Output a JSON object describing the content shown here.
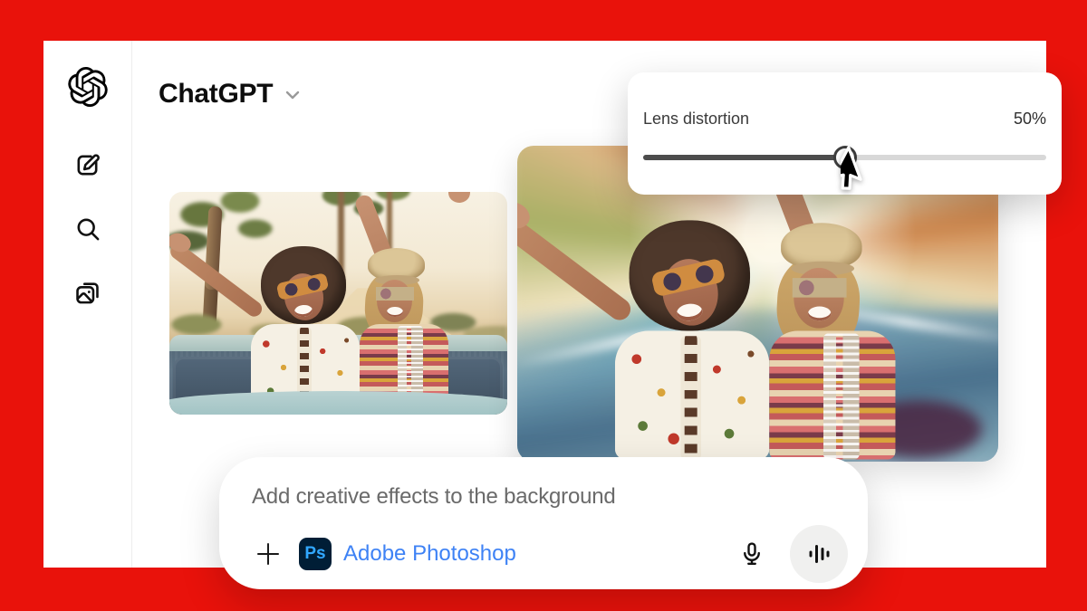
{
  "header": {
    "title": "ChatGPT",
    "dropdown_icon": "chevron-down-icon"
  },
  "sidebar": {
    "icons": [
      {
        "name": "openai-logo"
      },
      {
        "name": "new-chat-icon"
      },
      {
        "name": "search-icon"
      },
      {
        "name": "library-images-icon"
      }
    ]
  },
  "lens_panel": {
    "label": "Lens distortion",
    "value": "50%",
    "percent": 50
  },
  "composer": {
    "prompt": "Add creative effects to the background",
    "plus_icon": "plus-icon",
    "app_badge": "Ps",
    "app_name": "Adobe Photoshop",
    "mic_icon": "microphone-icon",
    "voice_icon": "voice-waveform-icon"
  },
  "colors": {
    "frame_red": "#e9120b",
    "accent_blue": "#3e82f5",
    "ps_badge_bg": "#001e36",
    "ps_badge_text": "#31a8ff",
    "slider_fill": "#4c4c4c",
    "slider_track": "#d8d8d8",
    "voice_circle_bg": "#f0f0ef"
  }
}
